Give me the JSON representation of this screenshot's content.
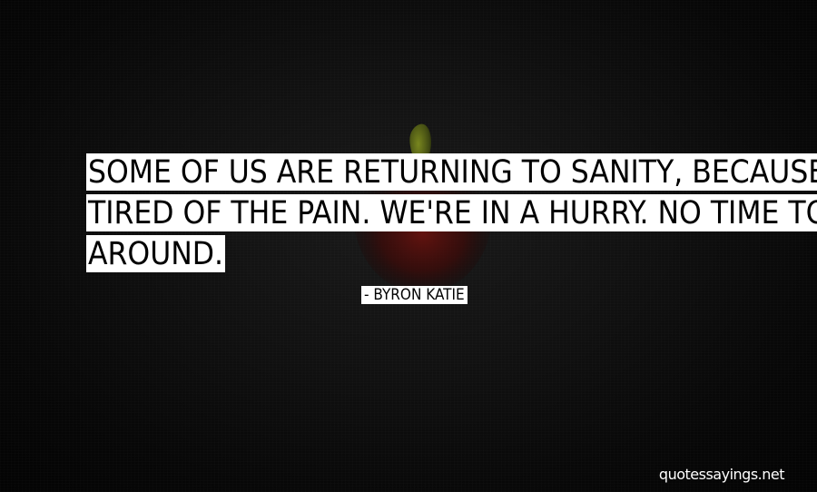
{
  "quote": {
    "lines": [
      "SOME OF US ARE RETURNING TO SANITY, BECAUSE WE'RE",
      "TIRED OF THE PAIN. WE'RE IN A HURRY. NO TIME TO MESS",
      "AROUND."
    ]
  },
  "author": "- BYRON KATIE",
  "watermark": "quotessayings.net",
  "background": {
    "base_color": "#0a0a0a",
    "apple_red": "#5a0d0a",
    "leaf_green": "#5b6a17",
    "highlight_color": "#ffffff",
    "text_color": "#000000",
    "image_icon": "apple-icon"
  }
}
